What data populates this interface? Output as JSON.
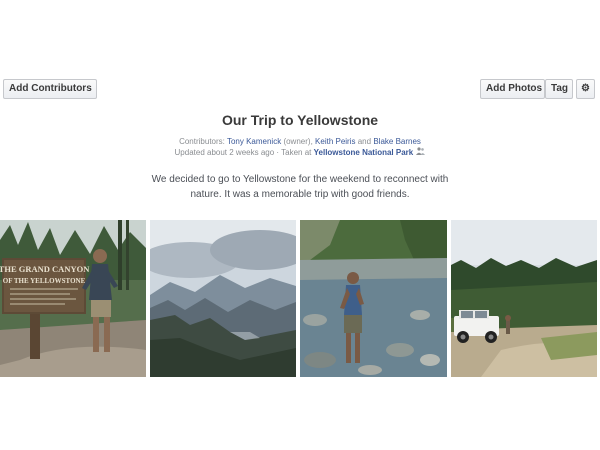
{
  "toolbar": {
    "add_contributors_label": "Add Contributors",
    "add_photos_label": "Add Photos",
    "tag_label": "Tag",
    "settings_icon": "gear-icon"
  },
  "album": {
    "title": "Our Trip to Yellowstone",
    "contributors_prefix": "Contributors:",
    "contributors": [
      {
        "name": "Tony Kamenick",
        "note": "(owner)"
      },
      {
        "name": "Keith Peiris"
      },
      {
        "name": "Blake Barnes"
      }
    ],
    "separator_comma": ",",
    "separator_and": "and",
    "updated_text": "Updated about 2 weeks ago",
    "taken_prefix": "· Taken at",
    "location": "Yellowstone National Park",
    "audience_icon": "people-icon",
    "description": "We decided to go to Yellowstone for the weekend to reconnect with nature. It was a memorable trip with good friends."
  },
  "photos": [
    {
      "name": "grand-canyon-sign-photo",
      "sign_line1": "THE GRAND CANYON",
      "sign_line2": "OF THE YELLOWSTONE"
    },
    {
      "name": "mountain-valley-photo"
    },
    {
      "name": "river-wading-photo"
    },
    {
      "name": "jeep-meadow-photo"
    }
  ],
  "colors": {
    "link": "#3b5998",
    "meta_text": "#8a8d91",
    "button_border": "#c6c8cc"
  }
}
